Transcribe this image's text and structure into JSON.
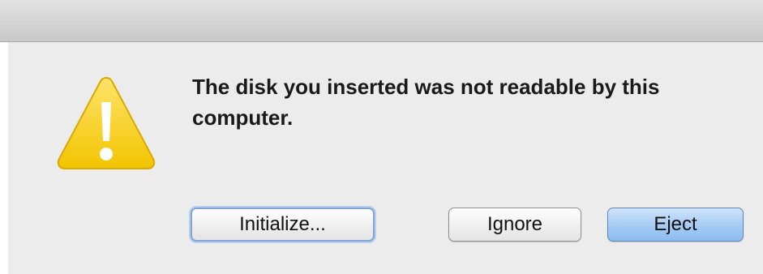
{
  "dialog": {
    "message": "The disk you inserted was not readable by this computer.",
    "icon": "warning-triangle-icon",
    "accent_color": "#f5c800"
  },
  "buttons": {
    "initialize": "Initialize...",
    "ignore": "Ignore",
    "eject": "Eject"
  },
  "colors": {
    "default_button": "#9cc4f2",
    "focus_ring": "#7fa6d6"
  }
}
